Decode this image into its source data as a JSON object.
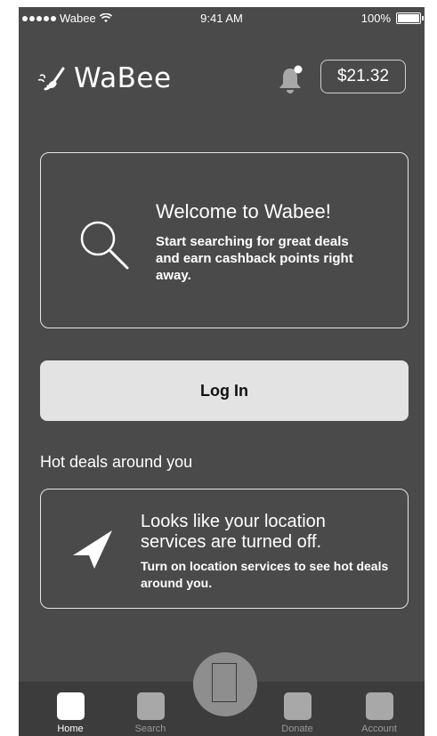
{
  "status_bar": {
    "carrier": "Wabee",
    "time": "9:41 AM",
    "battery": "100%"
  },
  "header": {
    "logo_text": "WaBee",
    "balance": "$21.32",
    "icons": [
      "bee-logo-icon",
      "bell-icon"
    ]
  },
  "welcome_card": {
    "title": "Welcome to Wabee!",
    "text": "Start searching for great deals and earn cashback points right away.",
    "icon": "search-icon"
  },
  "login_button": {
    "label": "Log In"
  },
  "hot_deals": {
    "title": "Hot deals around you",
    "card_title": "Looks like your location services are turned off.",
    "card_text": "Turn on location services to see hot deals around you.",
    "icon": "navigation-arrow-icon"
  },
  "tab_bar": {
    "tabs": [
      {
        "label": "Home",
        "active": true
      },
      {
        "label": "Search",
        "active": false
      },
      {
        "label": "Donate",
        "active": false
      },
      {
        "label": "Account",
        "active": false
      }
    ]
  },
  "colors": {
    "background": "#4a4a4a",
    "tab_bar": "#3c3c3c",
    "login_button": "#e3e3e3",
    "fab": "#8e8e8e"
  }
}
